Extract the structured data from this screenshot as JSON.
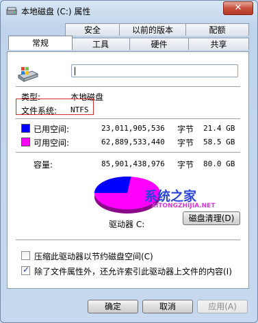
{
  "window": {
    "title": "本地磁盘 (C:) 属性",
    "close_glyph": "✕"
  },
  "tabs": {
    "row1": [
      "安全",
      "以前的版本",
      "配额"
    ],
    "row2": [
      "常规",
      "工具",
      "硬件",
      "共享"
    ],
    "active": "常规"
  },
  "general": {
    "drive_name_value": "",
    "type_label": "类型:",
    "type_value": "本地磁盘",
    "fs_label": "文件系统:",
    "fs_value": "NTFS",
    "used": {
      "label": "已用空间:",
      "bytes": "23,011,905,536",
      "unit": "字节",
      "size": "21.4 GB",
      "color": "#0000ff"
    },
    "free": {
      "label": "可用空间:",
      "bytes": "62,889,533,440",
      "unit": "字节",
      "size": "58.5 GB",
      "color": "#ff00ff"
    },
    "capacity": {
      "label": "容量:",
      "bytes": "85,901,438,976",
      "unit": "字节",
      "size": "80.0 GB"
    },
    "drive_label": "驱动器 C:",
    "cleanup_button": "磁盘清理(D)",
    "compress_label": "压缩此驱动器以节约磁盘空间(C)",
    "compress_checked": false,
    "index_label": "除了文件属性外，还允许索引此驱动器上文件的内容(I)",
    "index_checked": true,
    "pie": {
      "used_fraction": 0.268,
      "free_fraction": 0.732
    }
  },
  "buttons": {
    "ok": "确定",
    "cancel": "取消",
    "apply": "应用(A)"
  },
  "watermark": {
    "brand": "系统之家",
    "url": "XITONGZHIJIA.NET"
  }
}
